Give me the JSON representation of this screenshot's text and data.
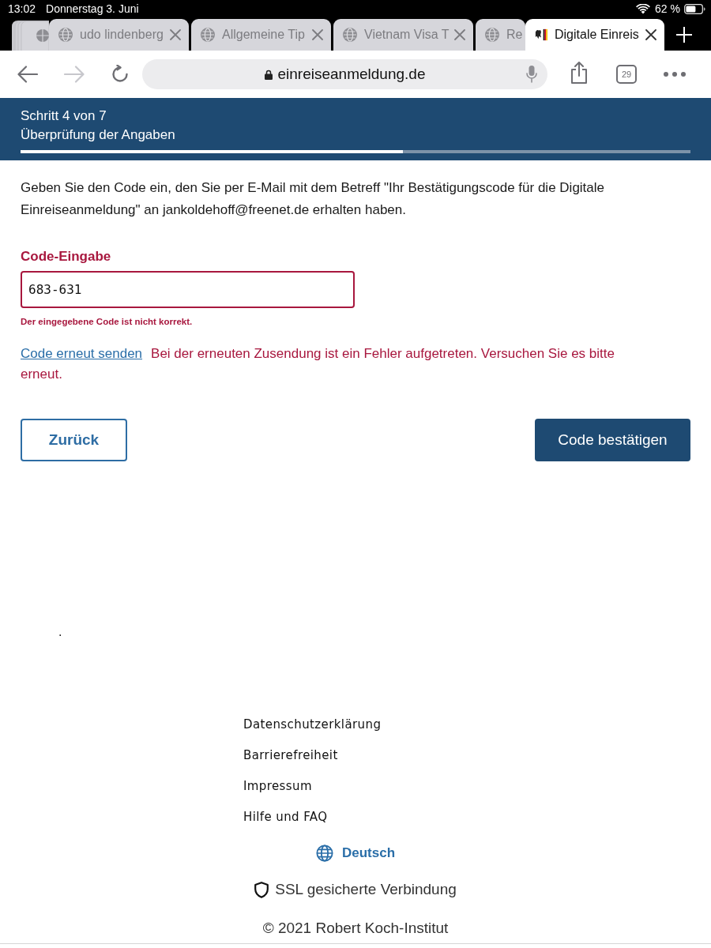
{
  "status_bar": {
    "time": "13:02",
    "date": "Donnerstag 3. Juni",
    "battery": "62 %"
  },
  "tabs": [
    {
      "title": "udo lindenberg",
      "kind": "generic",
      "selected": false
    },
    {
      "title": "Allgemeine Tip",
      "kind": "generic",
      "selected": false
    },
    {
      "title": "Vietnam Visa T",
      "kind": "generic",
      "selected": false
    },
    {
      "title": "Re",
      "kind": "generic",
      "selected": false
    },
    {
      "title": "Digitale Einreis",
      "kind": "branded",
      "selected": true
    }
  ],
  "toolbar": {
    "nav": [
      {
        "kind": "back",
        "disabled": false
      },
      {
        "kind": "forward",
        "disabled": true
      },
      {
        "kind": "reload",
        "disabled": false
      }
    ],
    "url": "einreiseanmeldung.de",
    "tab_count": "29"
  },
  "header": {
    "step": "Schritt 4 von 7",
    "title": "Überprüfung der Angaben",
    "progress": {
      "level": 0.571
    }
  },
  "intro": "Geben Sie den Code ein, den Sie per E-Mail mit dem Betreff \"Ihr Bestätigungscode für die Digitale Einreiseanmeldung\" an jankoldehoff@freenet.de erhalten haben.",
  "code_field": {
    "label": "Code-Eingabe",
    "value": "683-631",
    "invalid": true,
    "error": "Der eingegebene Code ist nicht korrekt."
  },
  "resend": {
    "link": "Code erneut senden",
    "error": "Bei der erneuten Zusendung ist ein Fehler aufgetreten. Versuchen Sie es bitte erneut."
  },
  "buttons": [
    {
      "label": "Zurück",
      "kind": "secondary"
    },
    {
      "label": "Code bestätigen",
      "kind": "primary"
    }
  ],
  "stray_text": ".",
  "footer": {
    "links": [
      "Datenschutzerklärung",
      "Barrierefreiheit",
      "Impressum",
      "Hilfe und FAQ"
    ],
    "language": "Deutsch",
    "security": "SSL gesicherte Verbindung",
    "copyright": "© 2021 Robert Koch-Institut"
  }
}
